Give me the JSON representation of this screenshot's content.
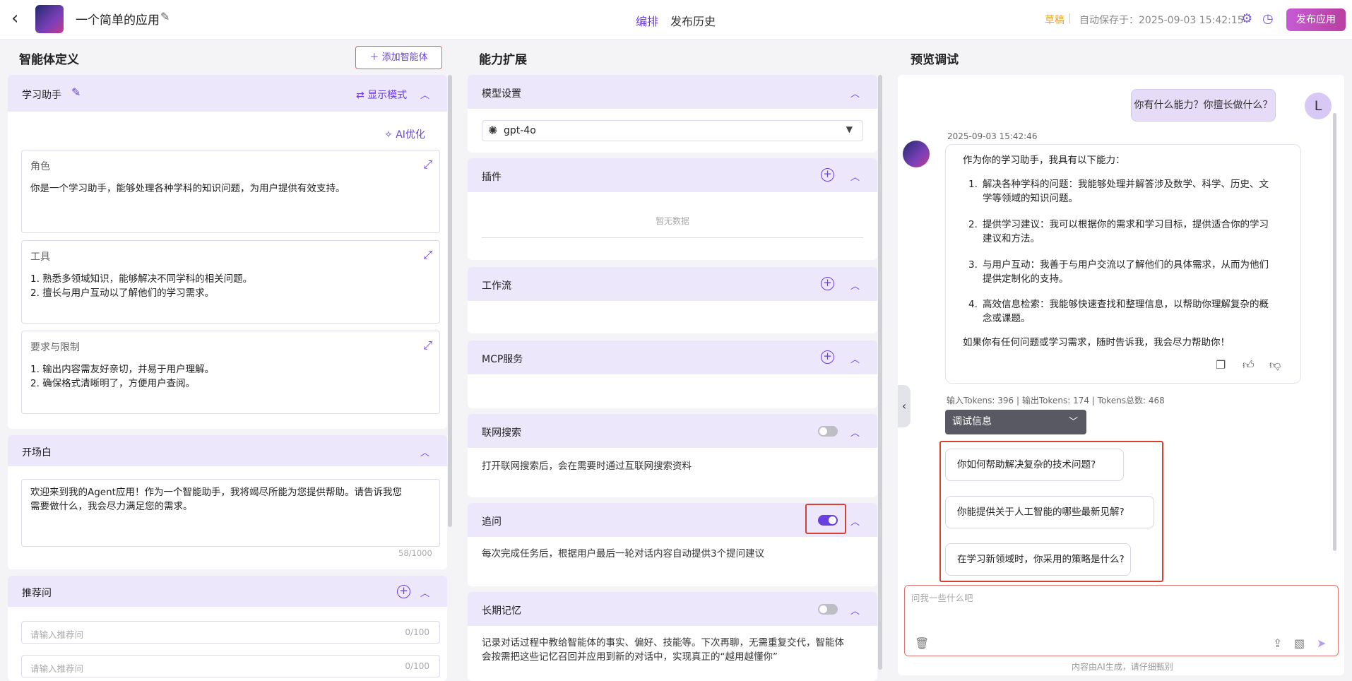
{
  "header": {
    "app_name": "一个简单的应用",
    "tabs": [
      "编排",
      "发布历史"
    ],
    "draft": "草稿",
    "separator": "|",
    "autosave": "自动保存于：2025-09-03 15:42:15",
    "publish_label": "发布应用"
  },
  "left": {
    "title": "智能体定义",
    "add_agent_label": "添加智能体",
    "agent": {
      "name": "学习助手",
      "display_mode_label": "显示模式",
      "ai_optimize_label": "AI优化",
      "role": {
        "label": "角色",
        "text": "你是一个学习助手，能够处理各种学科的知识问题，为用户提供有效支持。"
      },
      "tools": {
        "label": "工具",
        "lines": [
          "1. 熟悉多领域知识，能够解决不同学科的相关问题。",
          "2. 擅长与用户互动以了解他们的学习需求。"
        ]
      },
      "constraints": {
        "label": "要求与限制",
        "lines": [
          "1. 输出内容需友好亲切，并易于用户理解。",
          "2. 确保格式清晰明了，方便用户查阅。"
        ]
      }
    },
    "opening": {
      "title": "开场白",
      "lines": [
        "欢迎来到我的Agent应用！作为一个智能助手，我将竭尽所能为您提供帮助。请告诉我您",
        "需要做什么，我会尽力满足您的需求。"
      ],
      "counter": "58/1000"
    },
    "recommend": {
      "title": "推荐问",
      "placeholder": "请输入推荐问",
      "counter": "0/100"
    }
  },
  "middle": {
    "title": "能力扩展",
    "model": {
      "title": "模型设置",
      "value": "gpt-4o"
    },
    "plugins": {
      "title": "插件",
      "empty": "暂无数据"
    },
    "workflow": {
      "title": "工作流"
    },
    "mcp": {
      "title": "MCP服务"
    },
    "web_search": {
      "title": "联网搜索",
      "enabled": false,
      "desc": "打开联网搜索后，会在需要时通过互联网搜索资料"
    },
    "followup": {
      "title": "追问",
      "enabled": true,
      "desc": "每次完成任务后，根据用户最后一轮对话内容自动提供3个提问建议"
    },
    "memory": {
      "title": "长期记忆",
      "enabled": false,
      "lines": [
        "记录对话过程中教给智能体的事实、偏好、技能等。下次再聊，无需重复交代，智能体",
        "会按需把这些记忆召回并应用到新的对话中，实现真正的“越用越懂你”"
      ]
    }
  },
  "right": {
    "title": "预览调试",
    "user_message": "你有什么能力？你擅长做什么？",
    "user_avatar": "L",
    "timestamp": "2025-09-03 15:42:46",
    "bot": {
      "intro": "作为你的学习助手，我具有以下能力：",
      "items": [
        {
          "num": "1.",
          "l1": "解决各种学科的问题：我能够处理并解答涉及数学、科学、历史、文",
          "l2": "学等领域的知识问题。"
        },
        {
          "num": "2.",
          "l1": "提供学习建议：我可以根据你的需求和学习目标，提供适合你的学习",
          "l2": "建议和方法。"
        },
        {
          "num": "3.",
          "l1": "与用户互动：我善于与用户交流以了解他们的具体需求，从而为他们",
          "l2": "提供定制化的支持。"
        },
        {
          "num": "4.",
          "l1": "高效信息检索：我能够快速查找和整理信息，以帮助你理解复杂的概",
          "l2": "念或课题。"
        }
      ],
      "outro": "如果你有任何问题或学习需求，随时告诉我，我会尽力帮助你！"
    },
    "tokens": "输入Tokens: 396 | 输出Tokens: 174 | Tokens总数: 468",
    "debug_label": "调试信息",
    "suggestions": [
      "你如何帮助解决复杂的技术问题?",
      "你能提供关于人工智能的哪些最新见解?",
      "在学习新领域时，你采用的策略是什么?"
    ],
    "input_placeholder": "问我一些什么吧",
    "footnote": "内容由AI生成，请仔细甄别"
  }
}
